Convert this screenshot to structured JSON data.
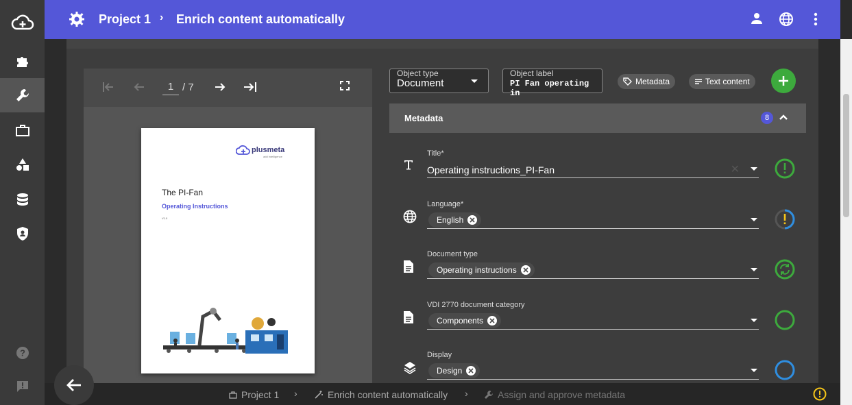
{
  "header": {
    "project": "Project 1",
    "page_title": "Enrich content automatically"
  },
  "sidebar": {
    "items": [
      "puzzle-icon",
      "wrench-icon",
      "briefcase-icon",
      "shapes-icon",
      "database-icon",
      "shield-icon",
      "help-icon",
      "feedback-icon"
    ]
  },
  "viewer": {
    "page": "1",
    "total": "/ 7"
  },
  "pdf": {
    "logo": "plusmeta",
    "logo_sub": "add intelligence",
    "title": "The PI-Fan",
    "subtitle": "Operating Instructions",
    "version": "V1.0"
  },
  "toolbar": {
    "object_type_label": "Object type",
    "object_type_value": "Document",
    "object_label_label": "Object label",
    "object_label_value": "PI Fan operating in",
    "metadata_chip": "Metadata",
    "text_content_chip": "Text content"
  },
  "metadata": {
    "title": "Metadata",
    "count": "8",
    "fields": [
      {
        "label": "Title*",
        "value": "Operating instructions_PI-Fan"
      },
      {
        "label": "Language*",
        "value": "English"
      },
      {
        "label": "Document type",
        "value": "Operating instructions"
      },
      {
        "label": "VDI 2770 document category",
        "value": "Components"
      },
      {
        "label": "Display",
        "value": "Design"
      }
    ]
  },
  "breadcrumb": {
    "project": "Project 1",
    "enrich": "Enrich content automatically",
    "assign": "Assign and approve metadata"
  },
  "colors": {
    "accent": "#5457d8",
    "success": "#3daa3d",
    "info": "#2f8ee0",
    "warning": "#f5c518"
  }
}
